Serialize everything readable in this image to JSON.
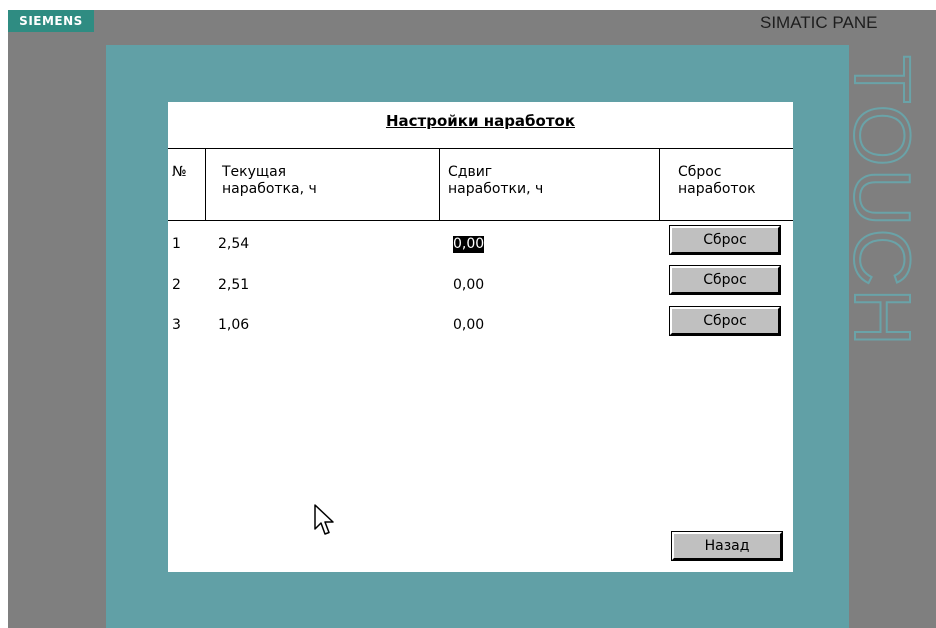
{
  "device": {
    "brand": "SIEMENS",
    "model": "SIMATIC PANE",
    "side_label": "TOUCH"
  },
  "dialog": {
    "title": "Настройки наработок",
    "columns": {
      "num": "№",
      "current_line1": "Текущая",
      "current_line2": "наработка, ч",
      "offset_line1": "Сдвиг",
      "offset_line2": "наработки, ч",
      "reset_line1": "Сброс",
      "reset_line2": "наработок"
    },
    "rows": [
      {
        "num": "1",
        "current": "2,54",
        "offset": "0,00",
        "reset_label": "Сброс"
      },
      {
        "num": "2",
        "current": "2,51",
        "offset": "0,00",
        "reset_label": "Сброс"
      },
      {
        "num": "3",
        "current": "1,06",
        "offset": "0,00",
        "reset_label": "Сброс"
      }
    ],
    "back_label": "Назад"
  },
  "colors": {
    "screen_background": "#61a0a6",
    "bezel": "#7f7f7f",
    "brand_green": "#2f8c82",
    "button_face": "#c0c0c0"
  },
  "icons": {
    "cursor": "mouse-pointer-icon"
  }
}
